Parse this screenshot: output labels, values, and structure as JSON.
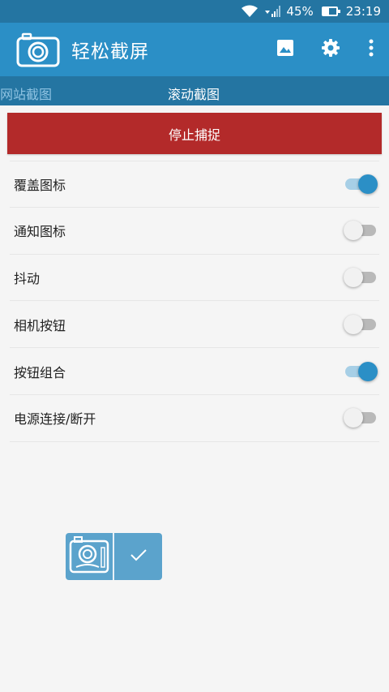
{
  "status_bar": {
    "battery_percent": "45%",
    "battery_level": 0.45,
    "time": "23:19",
    "icons": [
      "wifi-icon",
      "signal-icon",
      "battery-icon"
    ]
  },
  "app_bar": {
    "title": "轻松截屏",
    "logo_icon": "camera-icon",
    "actions": [
      "gallery-icon",
      "settings-gear-icon",
      "more-vertical-icon"
    ]
  },
  "tabs": [
    {
      "label": "网站截图",
      "active": false
    },
    {
      "label": "滚动截图",
      "active": true
    }
  ],
  "stop_button": {
    "label": "停止捕捉"
  },
  "settings": [
    {
      "label": "覆盖图标",
      "on": true
    },
    {
      "label": "通知图标",
      "on": false
    },
    {
      "label": "抖动",
      "on": false
    },
    {
      "label": "相机按钮",
      "on": false
    },
    {
      "label": "按钮组合",
      "on": true
    },
    {
      "label": "电源连接/断开",
      "on": false
    }
  ],
  "colors": {
    "status_bar": "#2475a2",
    "app_bar": "#2b8fc6",
    "tab_bar": "#2475a2",
    "stop_button": "#b32a2a",
    "toggle_on": "#2b8fc6",
    "float_widget": "#5ba3cc"
  },
  "float_widget": {
    "icons": [
      "camera-icon",
      "check-icon"
    ]
  }
}
